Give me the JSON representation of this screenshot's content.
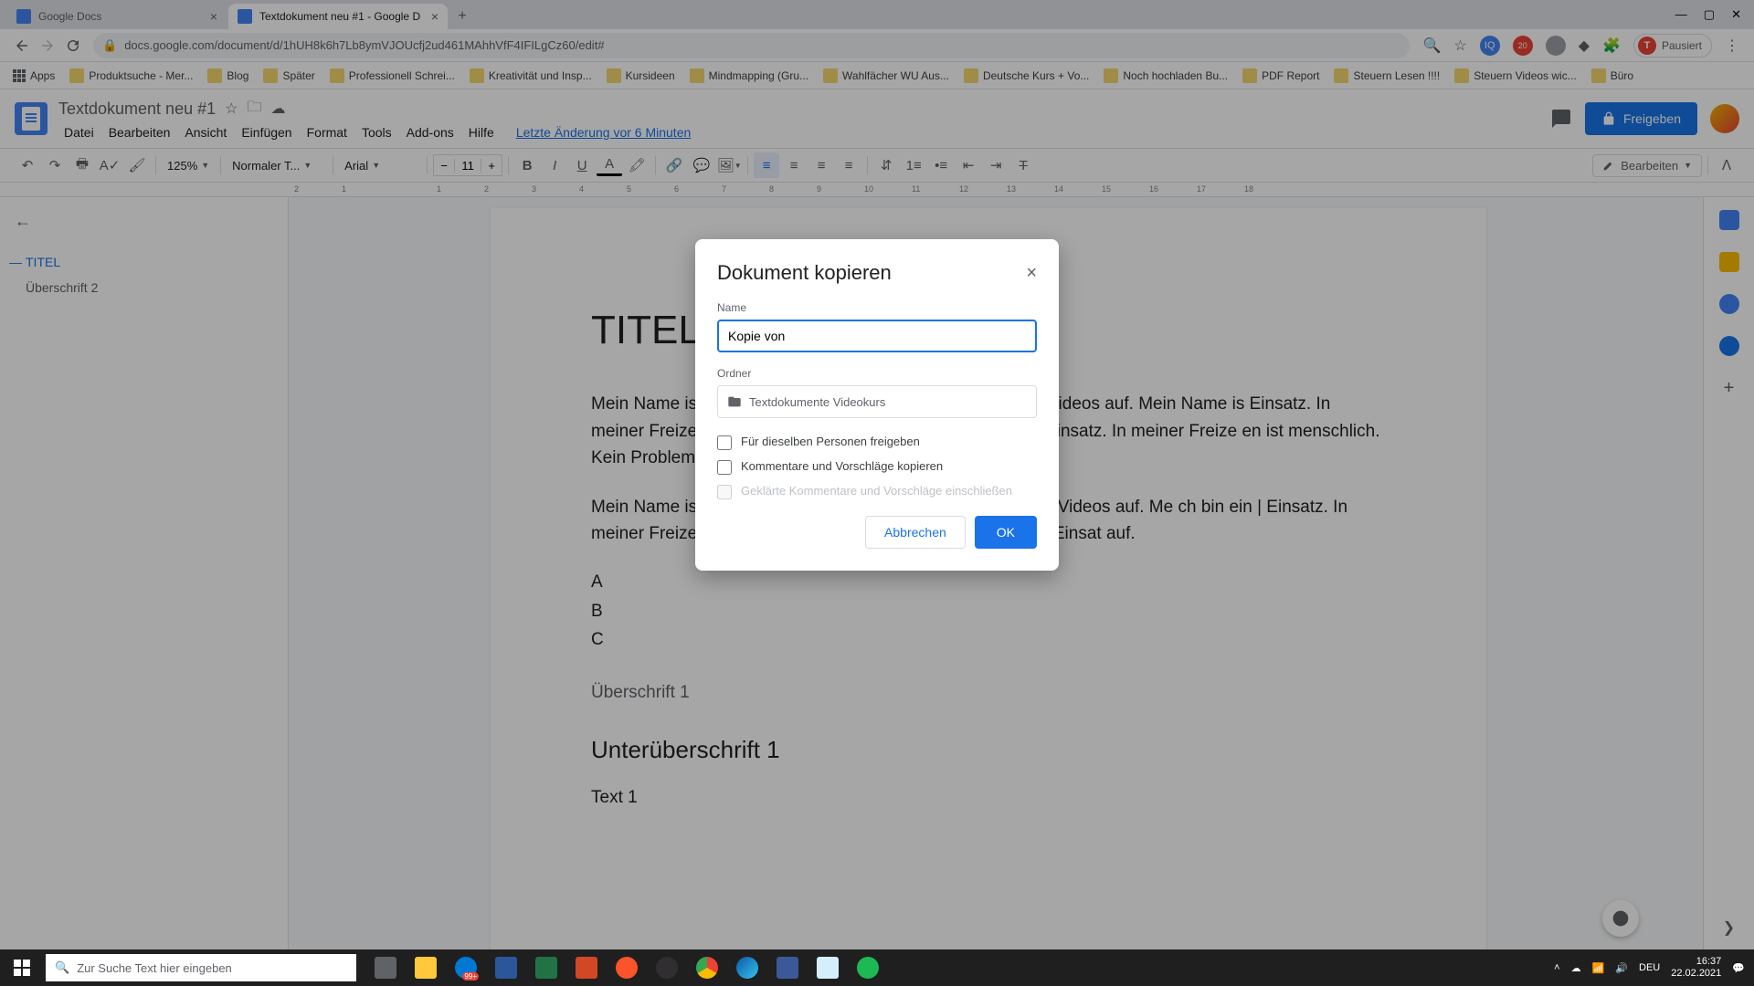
{
  "tabs": [
    {
      "title": "Google Docs",
      "active": false
    },
    {
      "title": "Textdokument neu #1 - Google D",
      "active": true
    }
  ],
  "url": "docs.google.com/document/d/1hUH8k6h7Lb8ymVJOUcfj2ud461MAhhVfF4IFILgCz60/edit#",
  "profile_status": "Pausiert",
  "bookmarks": [
    "Apps",
    "Produktsuche - Mer...",
    "Blog",
    "Später",
    "Professionell Schrei...",
    "Kreativität und Insp...",
    "Kursideen",
    "Mindmapping (Gru...",
    "Wahlfächer WU Aus...",
    "Deutsche Kurs + Vo...",
    "Noch hochladen Bu...",
    "PDF Report",
    "Steuern Lesen !!!!",
    "Steuern Videos wic...",
    "Büro"
  ],
  "doc": {
    "title": "Textdokument neu #1",
    "menus": [
      "Datei",
      "Bearbeiten",
      "Ansicht",
      "Einfügen",
      "Format",
      "Tools",
      "Add-ons",
      "Hilfe"
    ],
    "last_change": "Letzte Änderung vor 6 Minuten",
    "share": "Freigeben"
  },
  "toolbar": {
    "zoom": "125%",
    "style": "Normaler T...",
    "font": "Arial",
    "size": "11",
    "mode": "Bearbeiten"
  },
  "ruler_ticks": [
    "2",
    "1",
    "",
    "1",
    "2",
    "3",
    "4",
    "5",
    "6",
    "7",
    "8",
    "9",
    "10",
    "11",
    "12",
    "13",
    "14",
    "15",
    "16",
    "17",
    "18"
  ],
  "outline": [
    {
      "label": "TITEL",
      "active": true
    },
    {
      "label": "Überschrift 2",
      "active": false
    }
  ],
  "content": {
    "h1": "TITEL",
    "p1a": "Mein Name ist Tobias. Ich bin Stude",
    "p1link": "eizeit",
    "p1b": " nehme ich gerne Videos auf. Mein Name is                                                         Einsatz. In meiner Freizeit nehme ich gerne Vi                                                      ent in Wien. Ich bin ein Einsatz. In meiner Freize                                                                en ist menschlich. Kein Problem für mich.",
    "p2": "Mein Name ist Tobias. Ich bin Stude                                                             reizeit nehme ich gerne Videos auf. Me                                                                    ch bin ein | Einsatz. In meiner Freizeit nehme ic                                                                   ch bin Student in Wien. Ich bin ein Einsat                                                                            auf.",
    "listA": "A",
    "listB": "B",
    "listC": "C",
    "h3": "Überschrift 1",
    "h2": "Unterüberschrift 1",
    "p3": "Text 1"
  },
  "modal": {
    "title": "Dokument kopieren",
    "name_label": "Name",
    "name_value": "Kopie von ",
    "folder_label": "Ordner",
    "folder_value": "Textdokumente Videokurs",
    "chk1": "Für dieselben Personen freigeben",
    "chk2": "Kommentare und Vorschläge kopieren",
    "chk3": "Geklärte Kommentare und Vorschläge einschließen",
    "cancel": "Abbrechen",
    "ok": "OK"
  },
  "taskbar": {
    "search": "Zur Suche Text hier eingeben",
    "time": "16:37",
    "date": "22.02.2021",
    "lang": "DEU"
  }
}
